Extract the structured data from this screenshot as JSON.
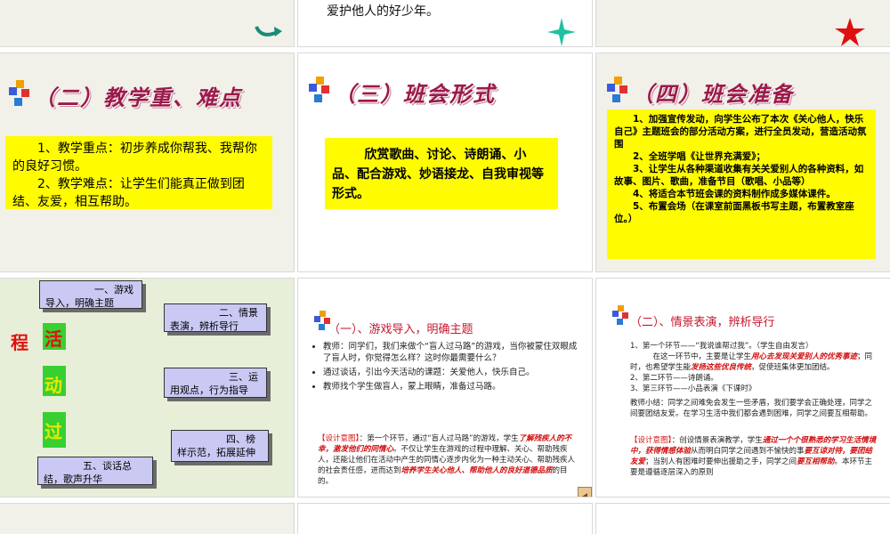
{
  "top_middle": {
    "text": "爱护他人的好少年。"
  },
  "slide_two": {
    "title": "（二）教学重、难点",
    "p1": "1、教学重点：初步养成你帮我、我帮你的良好习惯。",
    "p2": "2、教学难点：让学生们能真正做到团结、友爱，相互帮助。"
  },
  "slide_three": {
    "title": "（三）班会形式",
    "body": "欣赏歌曲、讨论、诗朗诵、小品、配合游戏、妙语接龙、自我审视等形式。"
  },
  "slide_four": {
    "title": "（四）班会准备",
    "items": [
      "1、加强宣传发动，向学生公布了本次《关心他人，快乐自己》主题班会的部分活动方案，进行全员发动，营造活动氛围",
      "2、全班学唱《让世界充满爱》；",
      "3、让学生从各种渠道收集有关关爱别人的各种资料，如故事、图片、歌曲，准备节目（歌唱、小品等）",
      "4、将适合本节班会课的资料制作成多媒体课件。",
      "5、布置会场（在课室前面黑板书写主题，布置教室座位。）"
    ]
  },
  "slide_flow": {
    "chars": [
      "程",
      "活",
      "动",
      "过"
    ],
    "boxes": [
      "一、游戏导入，明确主题",
      "二、情景表演，辨析导行",
      "三、运用观点，行为指导",
      "四、榜样示范，拓展延伸",
      "五、谈话总结，歌声升华"
    ]
  },
  "slide_game": {
    "title": "（一）、游戏导入，明确主题",
    "bullets": [
      "教师：同学们，我们来做个“盲人过马路”的游戏，当你被蒙住双眼成了盲人时，你觉得怎么样？这时你最需要什么？",
      "通过谈话，引出今天活动的课题：关爱他人，快乐自己。",
      "教师找个学生做盲人，蒙上眼睛，准备过马路。"
    ],
    "design_label": "【设计意图】",
    "design_a": "：第一个环节，通过“盲人过马路”的游戏，学生",
    "design_b": "了解残疾人的不幸，激发他们的同情心",
    "design_c": "。不仅让学生在游戏的过程中理解、关心、帮助残疾人，还能让他们在活动中产生的同情心逐步内化为一种主动关心、帮助残疾人的社会责任感，进而达到",
    "design_d": "培养学生关心他人、帮助他人的良好道德品质",
    "design_e": "的目的。"
  },
  "slide_scene": {
    "title": "（二）、情景表演，辨析导行",
    "l1": "1、第一个环节——“我说谁帮过我”。（学生自由发言）",
    "l2a": "在这一环节中，主要是让学生",
    "l2b": "用心去发现关爱别人的优秀事迹",
    "l2c": "；同时，也希望学生能",
    "l2d": "发扬这些优良传统",
    "l2e": "，促使班集体更加团结。",
    "l3": "2、第二环节——诗朗诵。",
    "l4": "3、第三环节——小品表演《下课时》",
    "l5": "教师小结：同学之间难免会发生一些矛盾，我们要学会正确处理，同学之间要团结友爱。在学习生活中我们都会遇到困难，同学之间要互相帮助。",
    "design_label": "【设计意图】",
    "d1": "：创设情景表演教学，学生",
    "d2": "通过一个个很熟悉的学习生活情境中，获得情感体验",
    "d3": "从而明白同学之间遇到不愉快的事",
    "d4": "要互谅对待，要团结友爱",
    "d5": "；当别人有困难时要伸出援助之手，同学之间",
    "d6": "要互相帮助",
    "d7": "。本环节主要是遵循逐层深入的原则"
  }
}
